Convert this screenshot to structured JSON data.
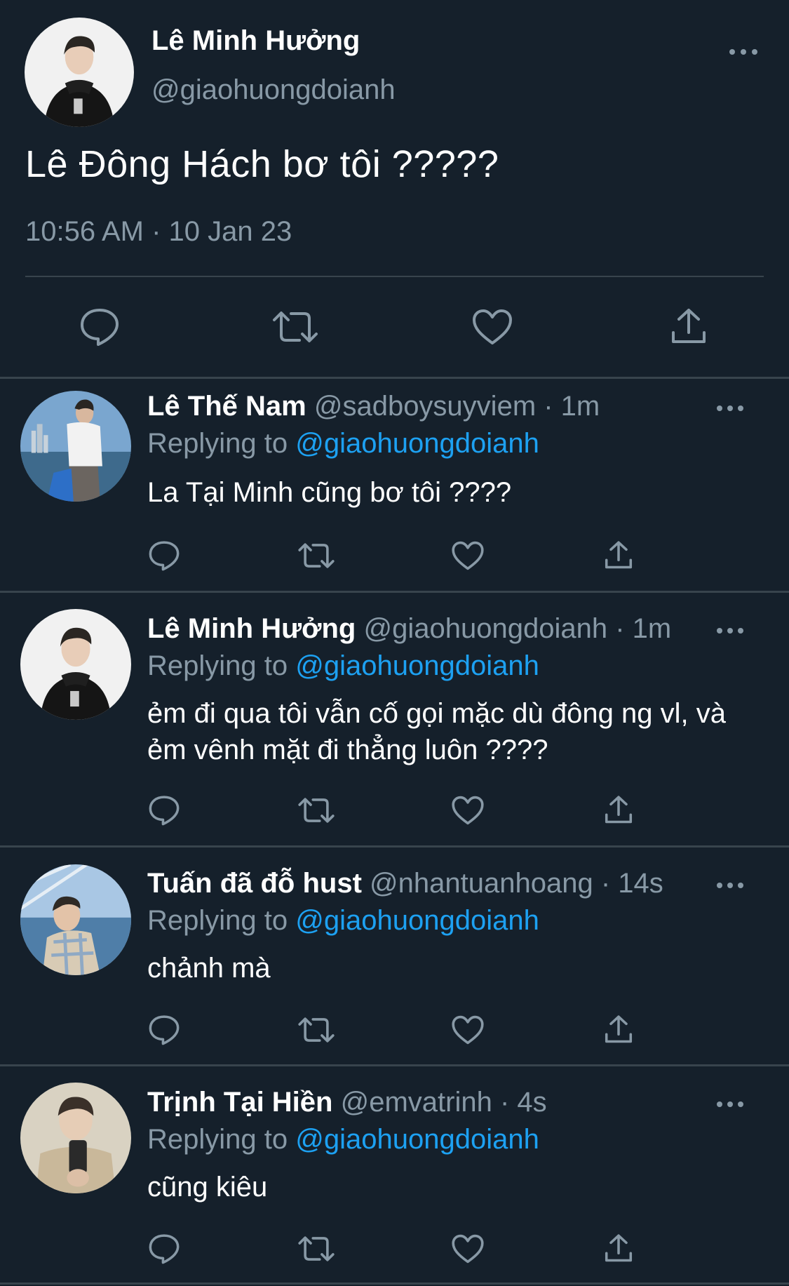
{
  "main_tweet": {
    "name": "Lê Minh Hưởng",
    "handle": "@giaohuongdoianh",
    "text": "Lê Đông Hách bơ tôi ?????",
    "timestamp": "10:56 AM · 10 Jan 23"
  },
  "replying_prefix": "Replying to ",
  "replies": [
    {
      "name": "Lê Thế Nam",
      "handle": "@sadboysuyviem · 1m",
      "replying_to": "@giaohuongdoianh",
      "text": "La Tại Minh cũng bơ tôi ????"
    },
    {
      "name": "Lê Minh Hưởng",
      "handle": "@giaohuongdoianh · 1m",
      "replying_to": "@giaohuongdoianh",
      "text": "ẻm đi qua tôi vẫn cố gọi mặc dù đông ng vl, và ẻm vênh mặt đi thẳng luôn ????"
    },
    {
      "name": "Tuấn đã đỗ hust",
      "handle": "@nhantuanhoang · 14s",
      "replying_to": "@giaohuongdoianh",
      "text": "chảnh mà"
    },
    {
      "name": "Trịnh Tại Hiền",
      "handle": "@emvatrinh · 4s",
      "replying_to": "@giaohuongdoianh",
      "text": "cũng kiêu"
    }
  ],
  "icons": {
    "reply": "reply-icon",
    "retweet": "retweet-icon",
    "like": "like-icon",
    "share": "share-icon",
    "more": "more-icon"
  },
  "colors": {
    "background": "#15202b",
    "divider": "#38444d",
    "secondary_text": "#8899a6",
    "link": "#1da1f2"
  }
}
